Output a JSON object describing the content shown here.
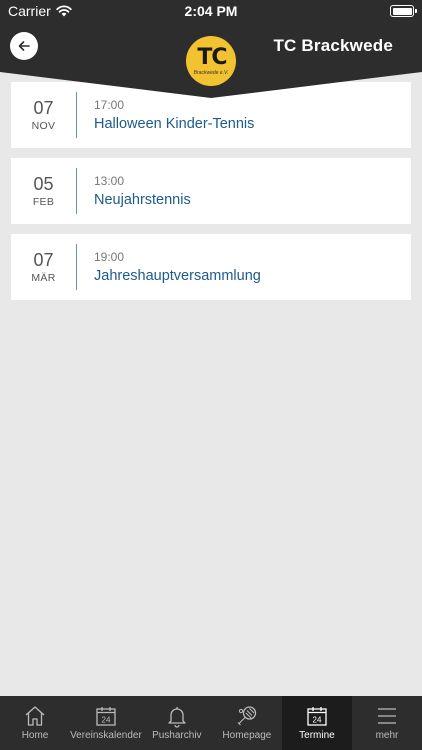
{
  "status": {
    "carrier": "Carrier",
    "time": "2:04 PM"
  },
  "header": {
    "title": "TC Brackwede",
    "logo_text": "TC",
    "logo_sub": "Brackwede e.V."
  },
  "events": [
    {
      "day": "07",
      "month": "NOV",
      "time": "17:00",
      "title": "Halloween Kinder-Tennis"
    },
    {
      "day": "05",
      "month": "FEB",
      "time": "13:00",
      "title": "Neujahrstennis"
    },
    {
      "day": "07",
      "month": "MÄR",
      "time": "19:00",
      "title": "Jahreshauptversammlung"
    }
  ],
  "tabbar": {
    "items": [
      {
        "label": "Home",
        "icon": "home-icon"
      },
      {
        "label": "Vereinskalender",
        "icon": "calendar-icon",
        "badge": "24"
      },
      {
        "label": "Pusharchiv",
        "icon": "bell-icon"
      },
      {
        "label": "Homepage",
        "icon": "tennis-racket-icon"
      },
      {
        "label": "Termine",
        "icon": "calendar-icon",
        "badge": "24",
        "active": true
      },
      {
        "label": "mehr",
        "icon": "menu-icon"
      }
    ]
  },
  "colors": {
    "header_bg": "#2d2d2d",
    "accent": "#1e5a8c",
    "logo_yellow": "#f2c230"
  }
}
